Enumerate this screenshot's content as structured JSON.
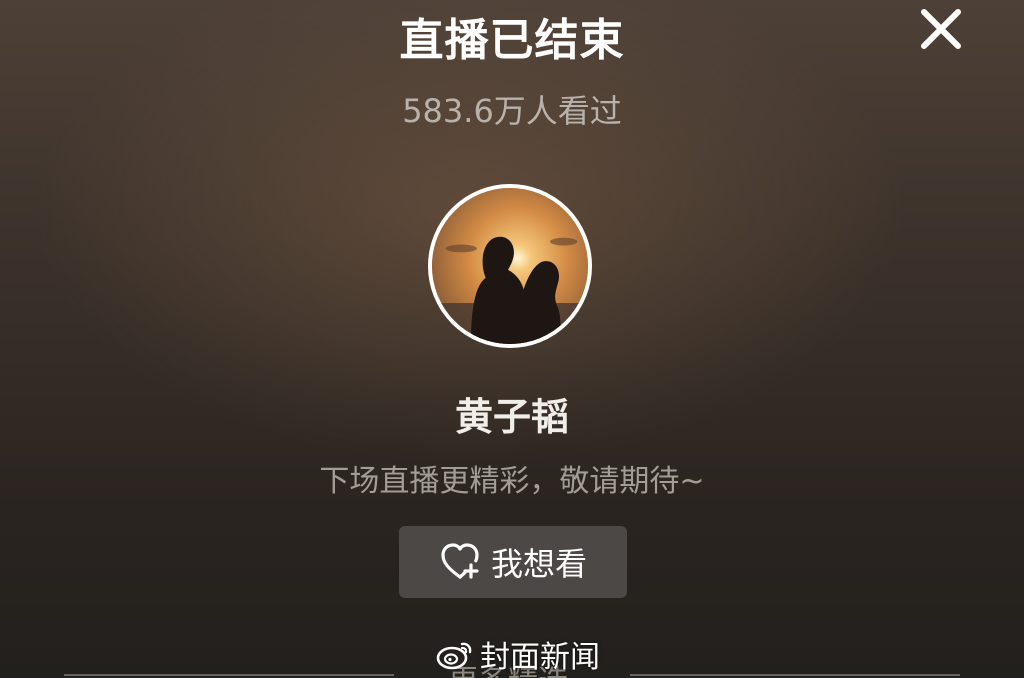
{
  "header": {
    "title": "直播已结束",
    "viewers": "583.6万人看过"
  },
  "streamer": {
    "name": "黄子韬",
    "notice": "下场直播更精彩，敬请期待~"
  },
  "actions": {
    "want_watch_label": "我想看"
  },
  "watermark": {
    "text": "封面新闻",
    "icon": "weibo-icon"
  },
  "footer": {
    "more_label": "更多精选"
  },
  "icons": {
    "close": "close-icon",
    "heart": "heart-plus-icon"
  },
  "colors": {
    "title": "#ffffff",
    "subtext": "#b9b2ab",
    "button_bg": "#4b4846"
  }
}
